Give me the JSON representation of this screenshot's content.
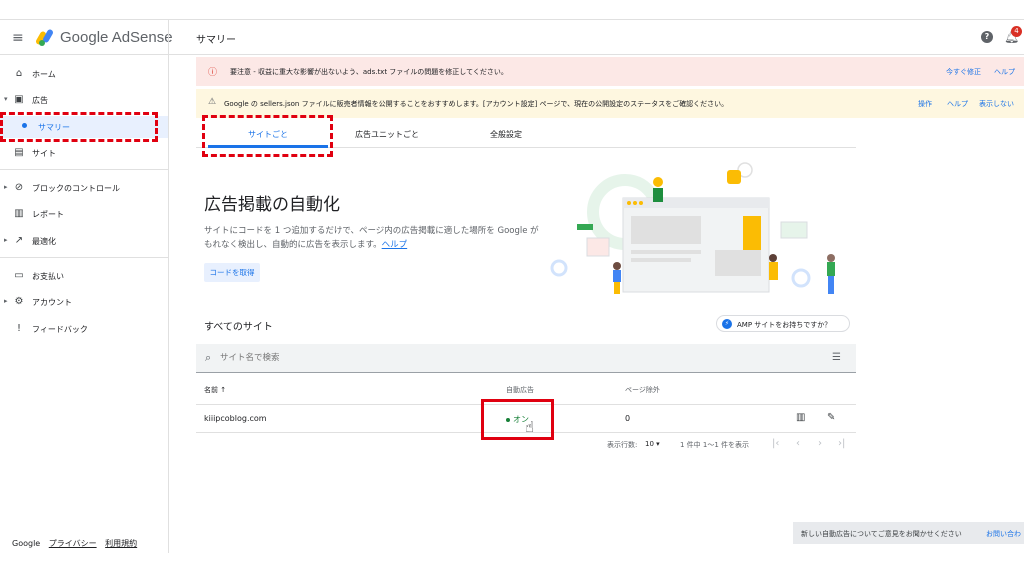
{
  "topbar": {
    "brand": "Google AdSense",
    "title": "サマリー",
    "notification_count": "4"
  },
  "sidebar": {
    "items": [
      {
        "label": "ホーム",
        "icon": "home-icon"
      },
      {
        "label": "広告",
        "icon": "ads-icon"
      },
      {
        "label": "サマリー"
      },
      {
        "label": "サイト",
        "icon": "sites-icon"
      },
      {
        "label": "ブロックのコントロール",
        "icon": "block-icon"
      },
      {
        "label": "レポート",
        "icon": "reports-icon"
      },
      {
        "label": "最適化",
        "icon": "optimize-icon"
      },
      {
        "label": "お支払い",
        "icon": "payments-icon"
      },
      {
        "label": "アカウント",
        "icon": "gear-icon"
      },
      {
        "label": "フィードバック",
        "icon": "feedback-icon"
      }
    ],
    "footer": {
      "google": "Google",
      "privacy": "プライバシー",
      "terms": "利用規約"
    }
  },
  "alerts": [
    {
      "text": "要注意 - 収益に重大な影響が出ないよう、ads.txt ファイルの問題を修正してください。",
      "actions": [
        "今すぐ修正",
        "ヘルプ"
      ],
      "color": "#fce8e6"
    },
    {
      "text": "Google の sellers.json ファイルに販売者情報を公開することをおすすめします。[アカウント設定] ページで、現在の公開設定のステータスをご確認ください。",
      "actions": [
        "操作",
        "ヘルプ",
        "表示しない"
      ],
      "color": "#fef7e0"
    }
  ],
  "tabs": [
    "サイトごと",
    "広告ユニットごと",
    "全般設定"
  ],
  "auto_ads": {
    "title": "広告掲載の自動化",
    "description": "サイトにコードを 1 つ追加するだけで、ページ内の広告掲載に適した場所を Google がもれなく検出し、自動的に広告を表示します。",
    "help_link": "ヘルプ",
    "button": "コードを取得"
  },
  "sites": {
    "heading": "すべてのサイト",
    "amp_chip": "AMP サイトをお持ちですか？",
    "search_placeholder": "サイト名で検索",
    "columns": {
      "name": "名前 ↑",
      "auto_ads": "自動広告",
      "excluded": "ページ除外"
    },
    "rows": [
      {
        "name": "kiiipcoblog.com",
        "status": "オン",
        "excluded": "0"
      }
    ],
    "pagination": {
      "rows_label": "表示行数:",
      "rows_value": "10",
      "range": "1 件中 1〜1 件を表示"
    }
  },
  "toast": {
    "text": "新しい自動広告についてご意見をお聞かせください",
    "action": "お問い合わ"
  }
}
